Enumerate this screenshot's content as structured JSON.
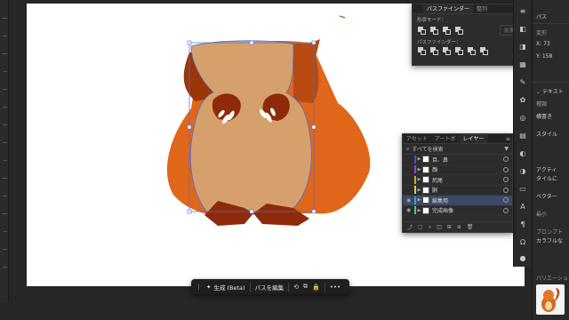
{
  "pathfinder_panel": {
    "tabs": [
      "",
      "パスファインダー",
      "整列"
    ],
    "active_tab": 1,
    "shape_mode_label": "形状モード：",
    "pathfinder_label": "パスファインダー：",
    "apply_label": "拡張"
  },
  "properties_panel": {
    "title": "パス",
    "transform_label": "変形",
    "x_label": "X",
    "x_value": "73",
    "y_label": "Y",
    "y_value": "158",
    "text_section": "テキスト",
    "kind_label": "種類",
    "kind_value": "横書き",
    "style_label": "スタイル",
    "activate_label": "アクティ",
    "tile_label": "タイルに",
    "vector_label": "ベクター",
    "prompt_label": "プロンプト",
    "prompt_value": "カラフルな",
    "variation_label": "バリエーション",
    "small_label": "最小"
  },
  "layers_panel": {
    "tabs": [
      "アセット",
      "アートボ",
      "レイヤー"
    ],
    "active_tab": 2,
    "search_placeholder": "すべてを検索",
    "rows": [
      {
        "name": "目、鼻",
        "color": "#3d55d6",
        "visible": false,
        "selected": false
      },
      {
        "name": "顔",
        "color": "#9b3fd6",
        "visible": false,
        "selected": false
      },
      {
        "name": "尻尾",
        "color": "#d6a43d",
        "visible": false,
        "selected": false
      },
      {
        "name": "胴",
        "color": "#d6d33d",
        "visible": false,
        "selected": false
      },
      {
        "name": "編集用",
        "color": "#3d9bd6",
        "visible": true,
        "selected": true
      },
      {
        "name": "完成画像",
        "color": "#3dd66a",
        "visible": true,
        "selected": false
      }
    ]
  },
  "taskbar": {
    "generate_label": "生成 (Beta)",
    "edit_path_label": "パスを編集",
    "more_label": "•••"
  },
  "colors": {
    "outer_orange": "#e0661a",
    "dark_brown": "#8e2a0a",
    "belly_tan": "#d6a06c",
    "selection_blue": "#4a6fd8",
    "layer_selected": "#3b4a66"
  }
}
